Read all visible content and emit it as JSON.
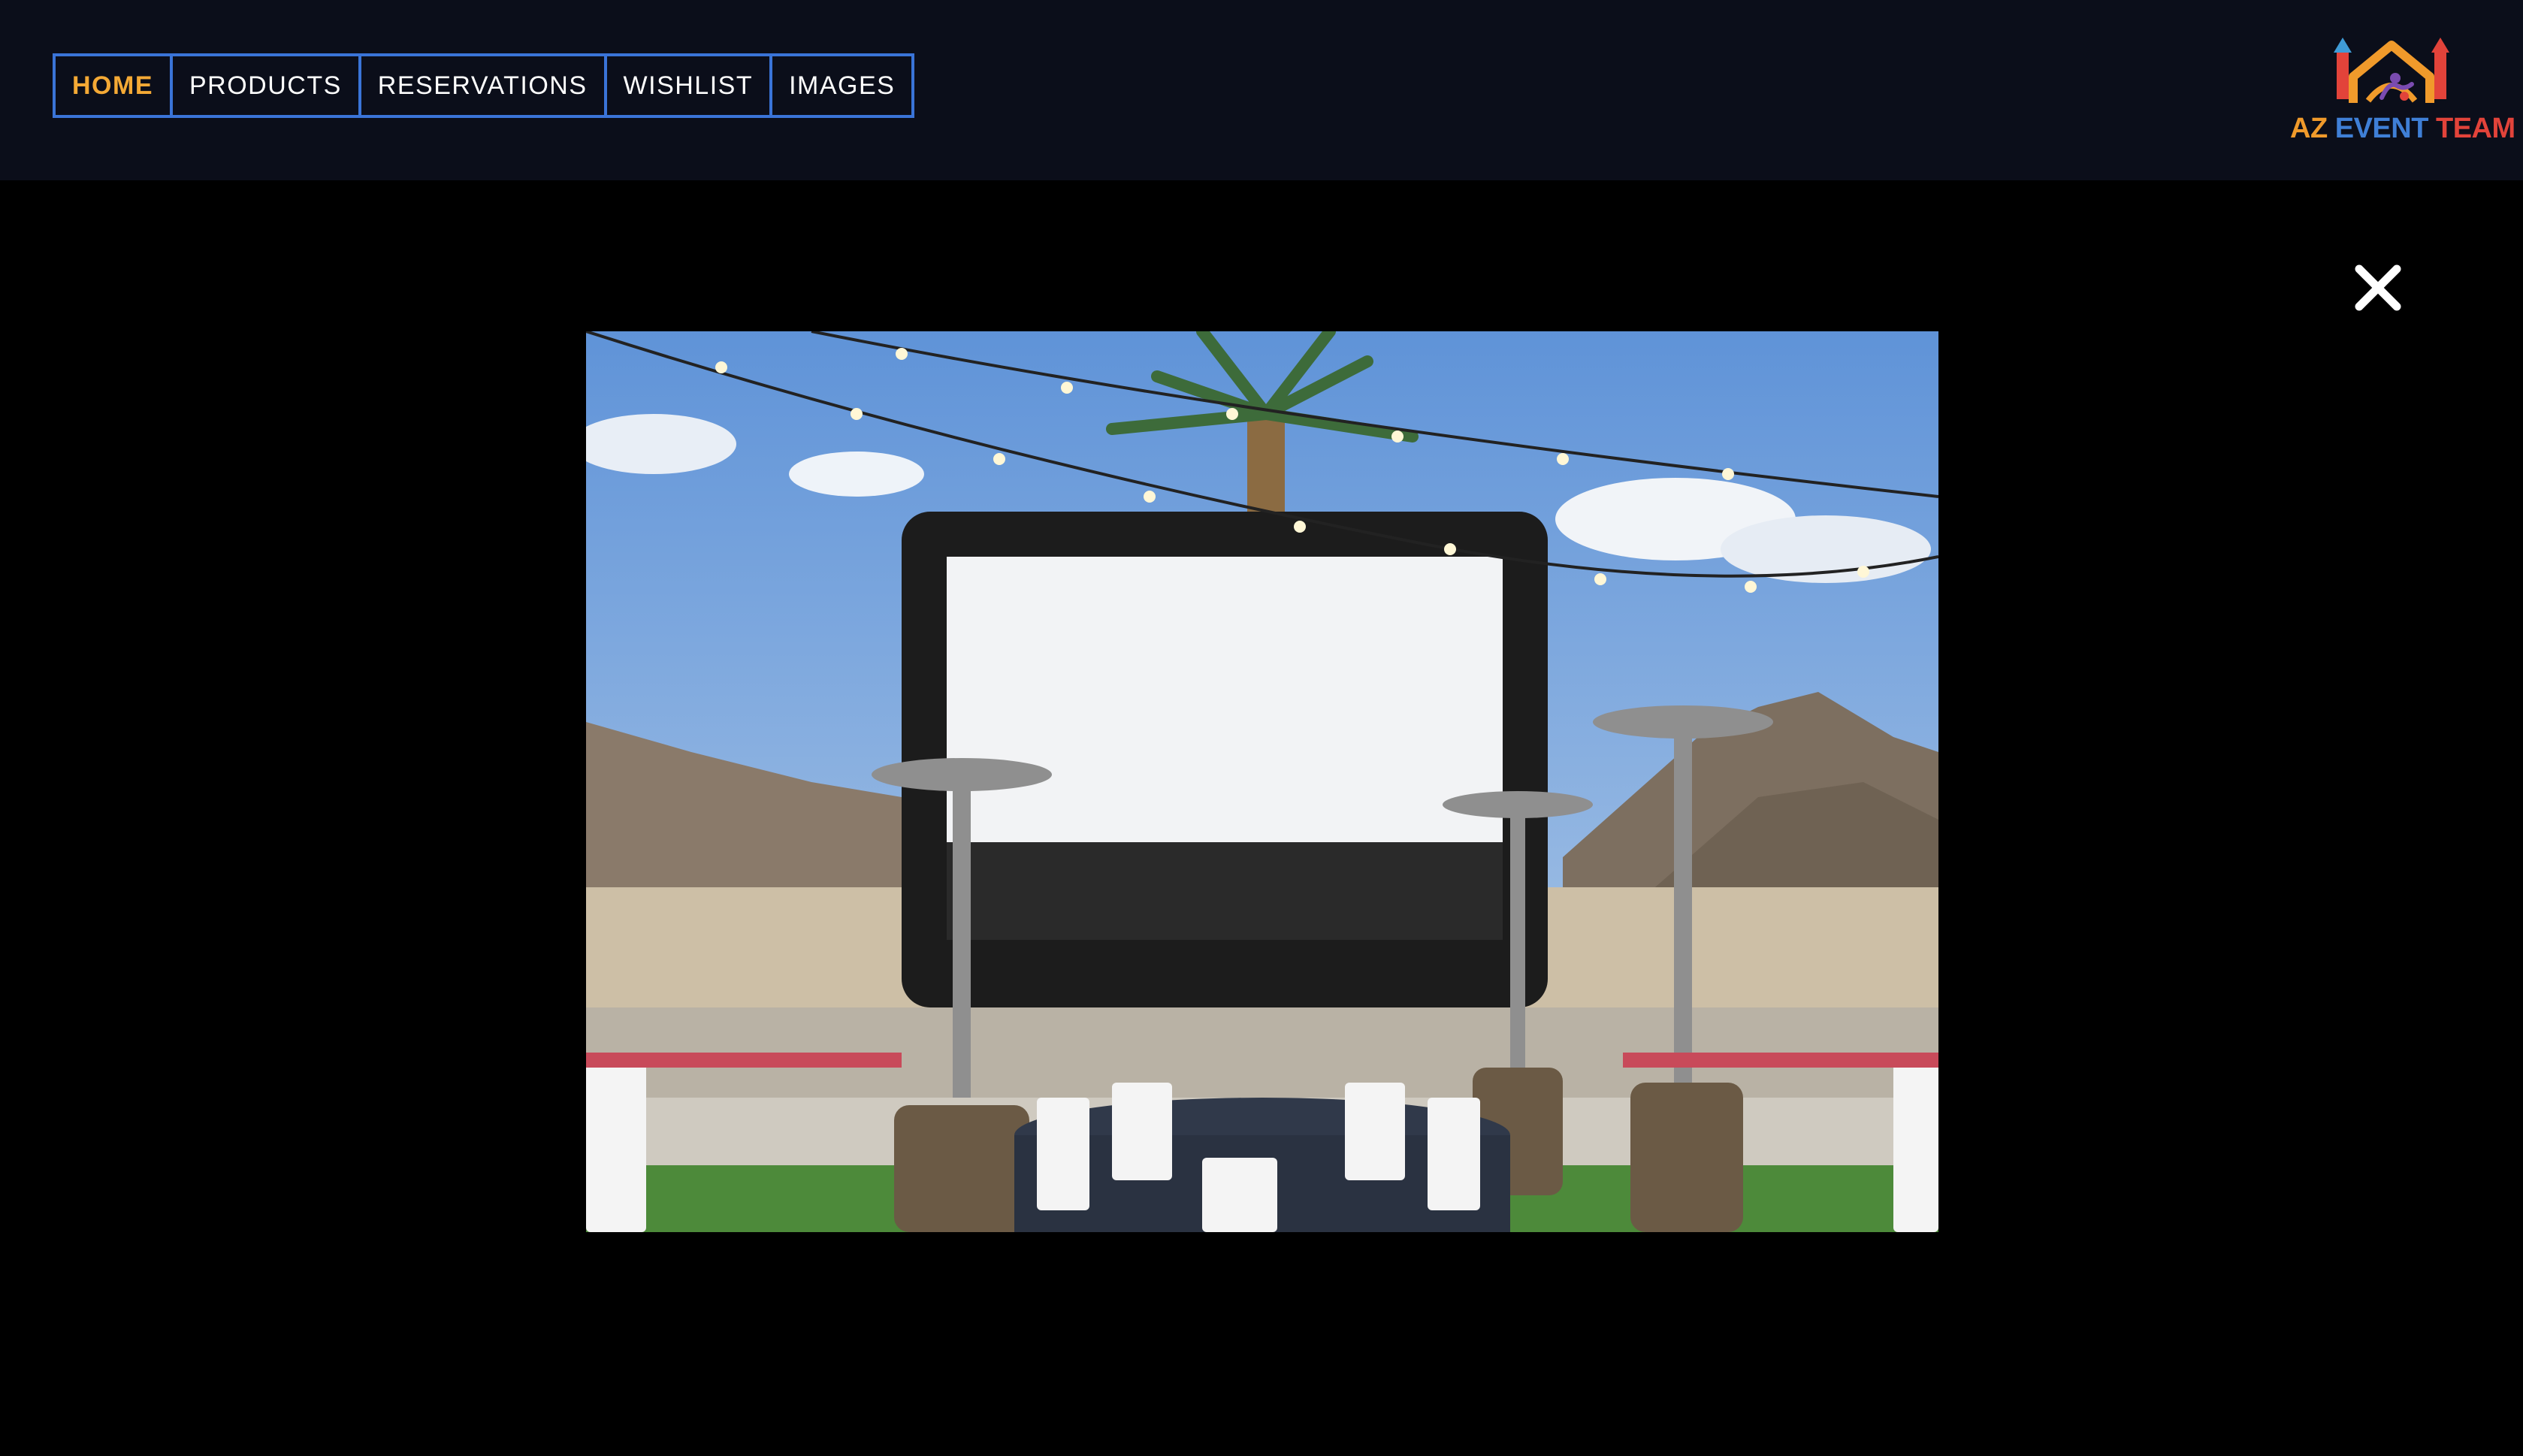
{
  "nav": {
    "items": [
      {
        "label": "HOME",
        "active": true
      },
      {
        "label": "PRODUCTS",
        "active": false
      },
      {
        "label": "RESERVATIONS",
        "active": false
      },
      {
        "label": "WISHLIST",
        "active": false
      },
      {
        "label": "IMAGES",
        "active": false
      }
    ]
  },
  "logo": {
    "word1": "AZ",
    "word2": "EVENT",
    "word3": "TEAM"
  },
  "lightbox": {
    "close_icon": "close-icon"
  },
  "colors": {
    "header_bg": "#0b0e1a",
    "nav_border": "#3a74d8",
    "active_nav": "#f4a935",
    "page_bg": "#000000"
  }
}
